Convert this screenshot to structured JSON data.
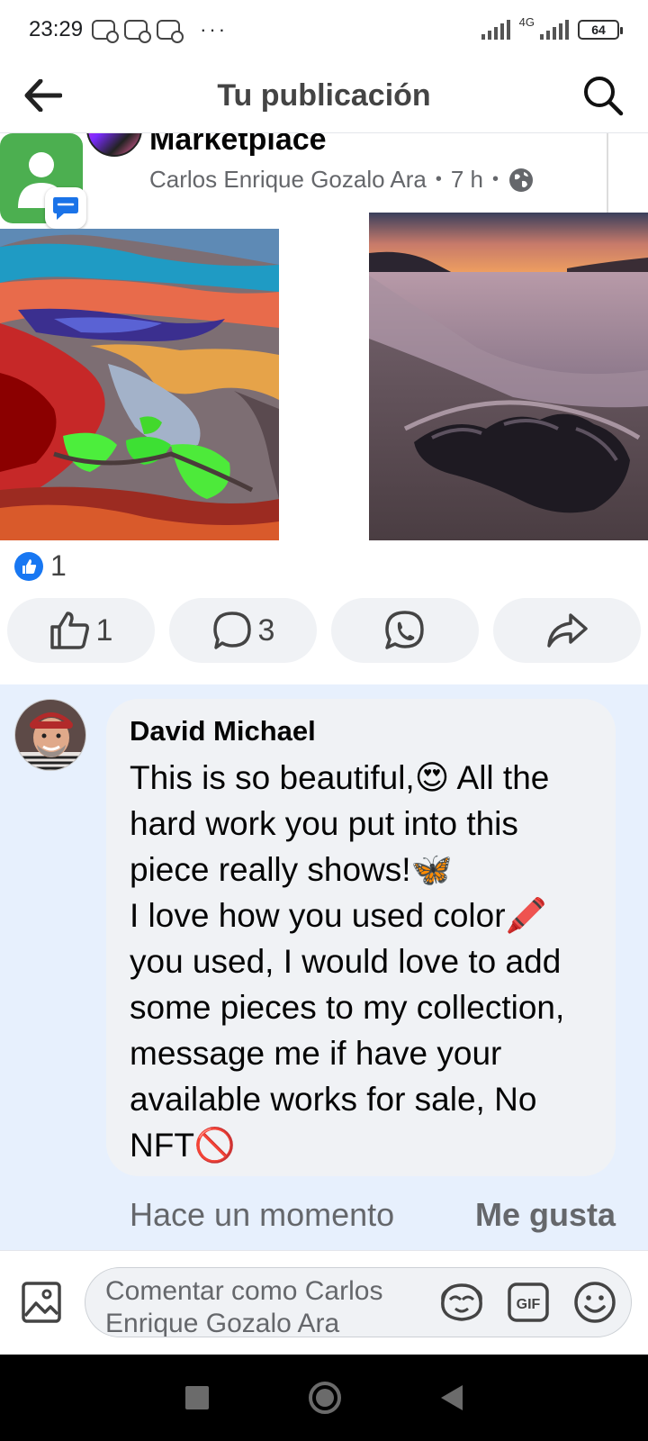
{
  "status_bar": {
    "time": "23:29",
    "more": "···",
    "network": "4G",
    "battery": "64"
  },
  "header": {
    "title": "Tu publicación"
  },
  "post": {
    "group_name": "Marketplace",
    "author": "Carlos Enrique Gozalo Ara",
    "time_ago": "7 h",
    "reaction_count": "1",
    "actions": {
      "like_count": "1",
      "comment_count": "3"
    }
  },
  "comment": {
    "author": "David Michael",
    "text": "This is so beautiful,😍 All the hard work you put into this piece really shows!🦋\nI love how you used color🖍️ you used, I would love to add some pieces to my collection, message me if have your available works for sale, No NFT🚫",
    "time": "Hace un momento",
    "like_label": "Me gusta"
  },
  "composer": {
    "placeholder": "Comentar como Carlos Enrique Gozalo Ara"
  },
  "colors": {
    "facebook_blue": "#1877f2",
    "comment_highlight": "#e7f0fd",
    "bubble": "#f0f2f5"
  }
}
